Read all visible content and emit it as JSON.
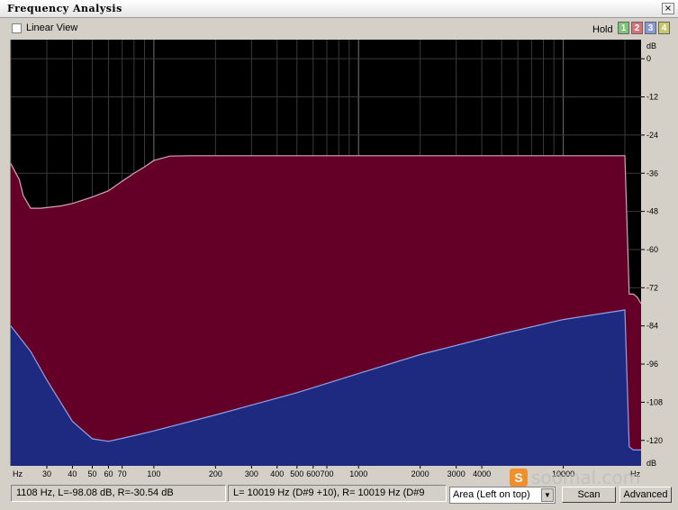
{
  "window": {
    "title": "Frequency Analysis",
    "close_glyph": "×"
  },
  "toolbar": {
    "linear_view_label": "Linear View",
    "linear_view_checked": false,
    "hold_label": "Hold",
    "hold_buttons": [
      {
        "label": "1",
        "color": "#7cc47a"
      },
      {
        "label": "2",
        "color": "#d9707a"
      },
      {
        "label": "3",
        "color": "#8899d8"
      },
      {
        "label": "4",
        "color": "#c8c86a"
      }
    ]
  },
  "chart_data": {
    "type": "area",
    "x_scale": "log",
    "x_unit": "Hz",
    "y_unit": "dB",
    "xlim": [
      20,
      24000
    ],
    "ylim": [
      -128,
      6
    ],
    "grid": true,
    "x_ticks": [
      "30",
      "40",
      "50",
      "60",
      "70",
      "100",
      "200",
      "300",
      "400",
      "500",
      "600",
      "700",
      "1000",
      "2000",
      "3000",
      "4000",
      "10000"
    ],
    "y_ticks": [
      0,
      -12,
      -24,
      -36,
      -48,
      -60,
      -72,
      -84,
      -96,
      -108,
      -120
    ],
    "series": [
      {
        "color": "#640028",
        "line_color": "#d6a4b6",
        "x": [
          20,
          22,
          23,
          25,
          28,
          35,
          40,
          50,
          60,
          70,
          80,
          90,
          100,
          120,
          150,
          200,
          400,
          1000,
          5000,
          10000,
          20000,
          21000,
          22000,
          23000,
          24000
        ],
        "y": [
          -33,
          -38,
          -43,
          -47,
          -47,
          -46.3,
          -45.5,
          -43.5,
          -41.5,
          -38.5,
          -36,
          -34,
          -32,
          -30.6,
          -30.5,
          -30.5,
          -30.5,
          -30.5,
          -30.5,
          -30.5,
          -30.5,
          -74,
          -74,
          -75,
          -77
        ]
      },
      {
        "color": "#1e2a80",
        "line_color": "#8fa0e8",
        "x": [
          20,
          25,
          30,
          40,
          50,
          60,
          80,
          100,
          200,
          500,
          1000,
          2000,
          5000,
          10000,
          20000,
          21000,
          22000,
          23000,
          24000
        ],
        "y": [
          -84,
          -92,
          -101,
          -114,
          -119.5,
          -120.3,
          -118.5,
          -117,
          -112,
          -105,
          -99,
          -93,
          -86.5,
          -82,
          -79,
          -122,
          -123,
          -123,
          -123
        ]
      }
    ]
  },
  "status": {
    "cursor_readout": "1108 Hz, L=-98.08 dB, R=-30.54 dB",
    "peak_readout": "L=  10019 Hz (D#9 +10), R=  10019 Hz (D#9",
    "view_mode": "Area (Left on top)",
    "scan_label": "Scan",
    "advanced_label": "Advanced"
  },
  "watermark": {
    "logo_text": "S",
    "site_text": "soomal.com"
  }
}
